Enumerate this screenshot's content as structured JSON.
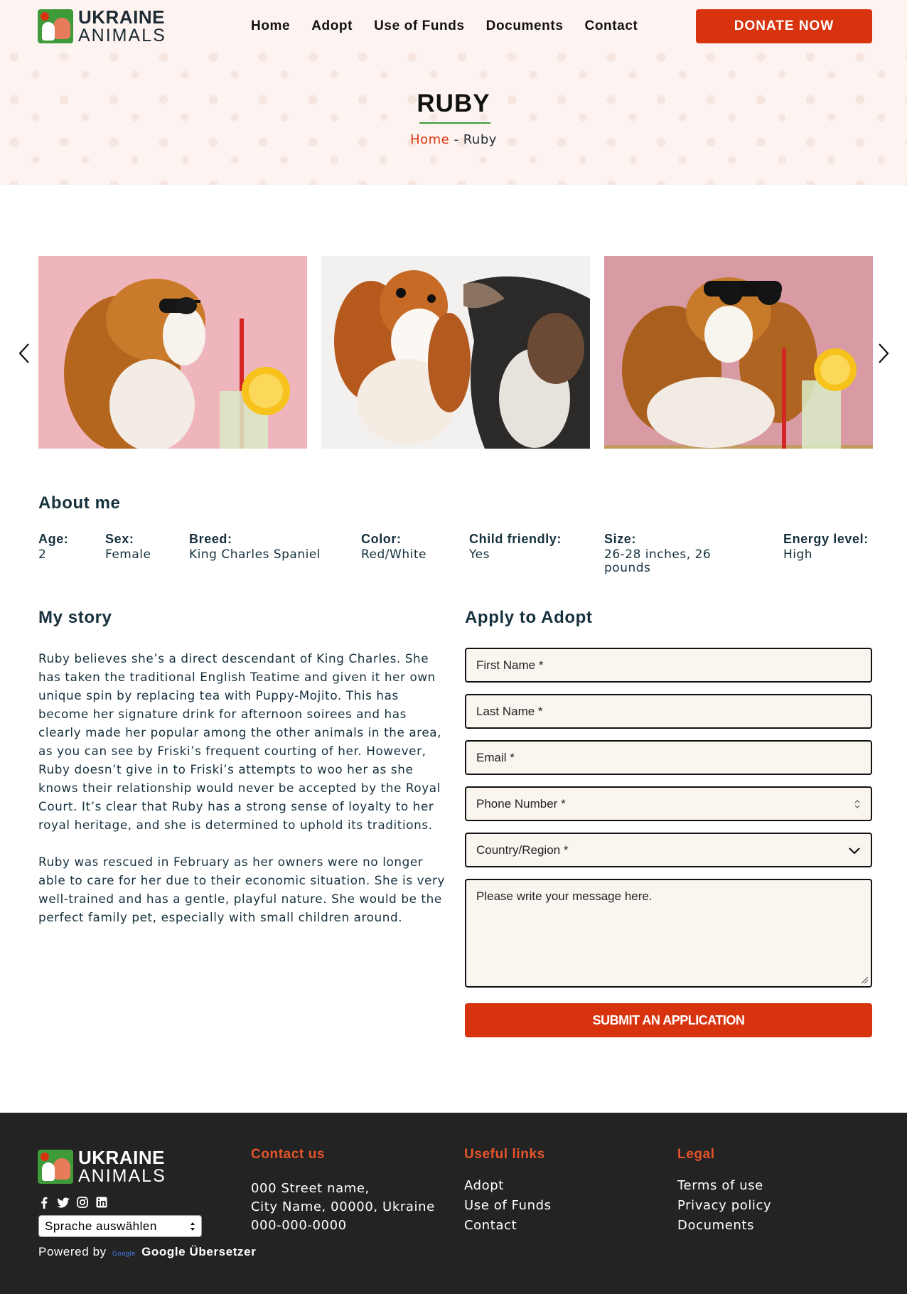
{
  "brand": {
    "line1": "UKRAINE",
    "line2": "ANIMALS"
  },
  "nav": {
    "items": [
      "Home",
      "Adopt",
      "Use of Funds",
      "Documents",
      "Contact"
    ],
    "donate_label": "DONATE NOW"
  },
  "hero": {
    "title": "RUBY",
    "breadcrumb_home": "Home",
    "breadcrumb_sep": "-",
    "breadcrumb_current": "Ruby"
  },
  "about": {
    "heading": "About me",
    "attributes": [
      {
        "label": "Age:",
        "value": "2"
      },
      {
        "label": "Sex:",
        "value": "Female"
      },
      {
        "label": "Breed:",
        "value": "King Charles Spaniel"
      },
      {
        "label": "Color:",
        "value": "Red/White"
      },
      {
        "label": "Child friendly:",
        "value": "Yes"
      },
      {
        "label": "Size:",
        "value": "26-28 inches, 26 pounds"
      },
      {
        "label": "Energy level:",
        "value": "High"
      }
    ]
  },
  "story": {
    "heading": "My story",
    "paragraphs": [
      "Ruby believes she’s a direct descendant of King Charles. She has taken the traditional English Teatime and given it her own unique spin by replacing tea with Puppy-Mojito. This has become her signature drink for afternoon soirees and has clearly made her popular among the other animals in the area, as you can see by Friski’s frequent courting of her. However, Ruby doesn’t give in to Friski’s attempts to woo her as she knows their relationship would never be accepted by the Royal Court. It’s clear that Ruby has a strong sense of loyalty to her royal heritage, and she is determined to uphold its traditions.",
      "Ruby was rescued in February as her owners were no longer able to care for her due to their economic situation. She is very well-trained and has a gentle, playful nature. She would be the perfect family pet, especially with small children around."
    ]
  },
  "form": {
    "heading": "Apply to Adopt",
    "first_name": "First Name *",
    "last_name": "Last Name *",
    "email": "Email *",
    "phone": "Phone Number *",
    "country": "Country/Region *",
    "message": "Please write your message here.",
    "submit_label": "SUBMIT AN APPLICATION"
  },
  "footer": {
    "contact_heading": "Contact us",
    "contact_lines": [
      "000 Street name,",
      "City Name, 00000, Ukraine",
      "000-000-0000"
    ],
    "links_heading": "Useful links",
    "links": [
      "Adopt",
      "Use of Funds",
      "Contact"
    ],
    "legal_heading": "Legal",
    "legal": [
      "Terms of use",
      "Privacy policy",
      "Documents"
    ],
    "language_select": "Sprache auswählen",
    "powered_prefix": "Powered by",
    "powered_google_small": "Google",
    "powered_service": "Google Übersetzer"
  },
  "colors": {
    "accent": "#d8330f",
    "green": "#3f9a3a",
    "footer_bg": "#232323",
    "footer_heading": "#e5542b"
  },
  "icons": [
    "chevron-left-icon",
    "chevron-right-icon",
    "facebook-icon",
    "twitter-icon",
    "instagram-icon",
    "linkedin-icon",
    "chevron-down-icon"
  ]
}
